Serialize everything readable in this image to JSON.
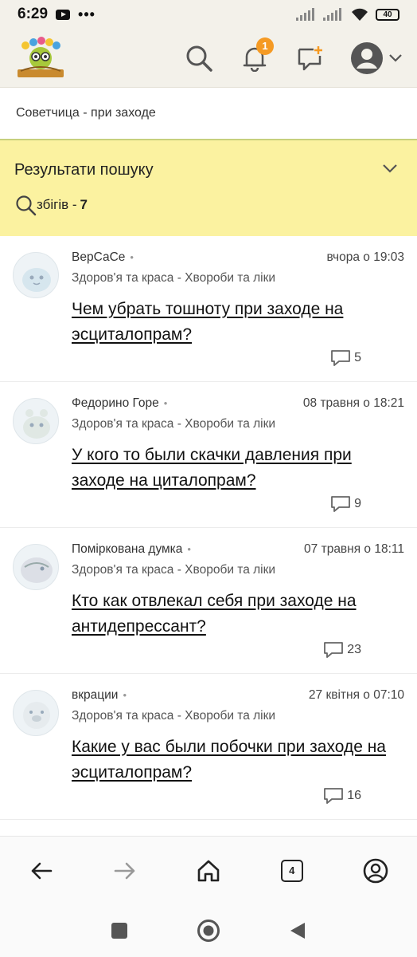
{
  "status_bar": {
    "time": "6:29",
    "dots": "•••",
    "battery": "40"
  },
  "header": {
    "notification_count": "1"
  },
  "breadcrumb": "Советчица - при заходе",
  "results": {
    "title": "Результати пошуку",
    "count_label": "збігів -",
    "count": "7"
  },
  "items": [
    {
      "author": "ВерСаСе",
      "dot": "•",
      "date": "вчора о 19:03",
      "category": "Здоров'я та краса - Хвороби та ліки",
      "topic": "Чем убрать тошноту при заходе на эсциталопрам?",
      "comments": "5"
    },
    {
      "author": "Федорино Горе",
      "dot": "•",
      "date": "08 травня о 18:21",
      "category": "Здоров'я та краса - Хвороби та ліки",
      "topic": "У кого то были скачки давления при заходе на циталопрам?",
      "comments": "9"
    },
    {
      "author": "Помірковaна думка",
      "dot": "•",
      "date": "07 травня о 18:11",
      "category": "Здоров'я та краса - Хвороби та ліки",
      "topic": "Кто как отвлекал себя при заходе на антидепрессант?",
      "comments": "23"
    },
    {
      "author": "вкрации",
      "dot": "•",
      "date": "27 квітня о 07:10",
      "category": "Здоров'я та краса - Хвороби та ліки",
      "topic": "Какие у вас были побочки при заходе на эсциталопрам?",
      "comments": "16"
    }
  ],
  "browser_bar": {
    "tabs_count": "4"
  },
  "colors": {
    "accent": "#f59a23",
    "results_bg": "#fbf2a0",
    "header_bg": "#f3f1ea"
  }
}
